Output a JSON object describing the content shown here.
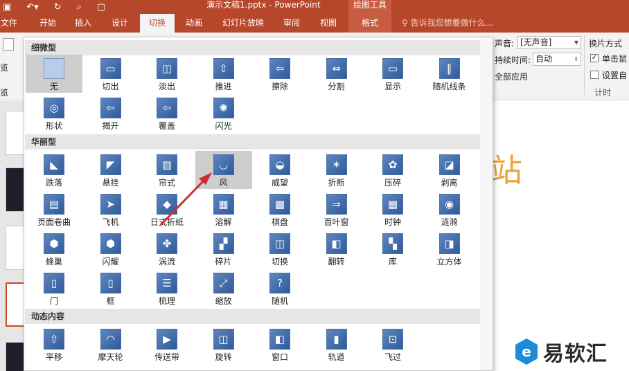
{
  "titlebar": {
    "doc_title": "演示文稿1.pptx - PowerPoint",
    "contextual_group": "绘图工具"
  },
  "tabs": [
    {
      "label": "文件"
    },
    {
      "label": "开始"
    },
    {
      "label": "插入"
    },
    {
      "label": "设计"
    },
    {
      "label": "切换"
    },
    {
      "label": "动画"
    },
    {
      "label": "幻灯片放映"
    },
    {
      "label": "审阅"
    },
    {
      "label": "视图"
    },
    {
      "label": "格式"
    }
  ],
  "tell_me": "告诉我您想要做什么...",
  "ribbon": {
    "preview_label": "览",
    "preview_label2": "览",
    "sound_label": "声音:",
    "sound_value": "[无声音]",
    "duration_label": "持续时间:",
    "duration_value": "自动",
    "apply_all": "全部应用",
    "advance_title": "换片方式",
    "on_click": "单击鼠",
    "after": "设置自",
    "timing_group": "计时"
  },
  "slide_text": "站",
  "gallery": {
    "sections": [
      {
        "title": "细微型",
        "items": [
          "无",
          "切出",
          "淡出",
          "推进",
          "擦除",
          "分割",
          "显示",
          "随机线条",
          "形状",
          "揭开",
          "覆盖",
          "闪光"
        ]
      },
      {
        "title": "华丽型",
        "items": [
          "跌落",
          "悬挂",
          "帘式",
          "风",
          "威望",
          "折断",
          "压碎",
          "剥离",
          "页面卷曲",
          "飞机",
          "日式折纸",
          "溶解",
          "棋盘",
          "百叶窗",
          "时钟",
          "涟漪",
          "蜂巢",
          "闪耀",
          "涡流",
          "碎片",
          "切换",
          "翻转",
          "库",
          "立方体",
          "门",
          "框",
          "梳理",
          "缩放",
          "随机"
        ]
      },
      {
        "title": "动态内容",
        "items": [
          "平移",
          "摩天轮",
          "传送带",
          "旋转",
          "窗口",
          "轨道",
          "飞过"
        ]
      }
    ]
  },
  "watermark": "易软汇",
  "colors": {
    "accent": "#b7472a",
    "icon_blue": "#2f5b9b",
    "arrow": "#d32b2b"
  }
}
